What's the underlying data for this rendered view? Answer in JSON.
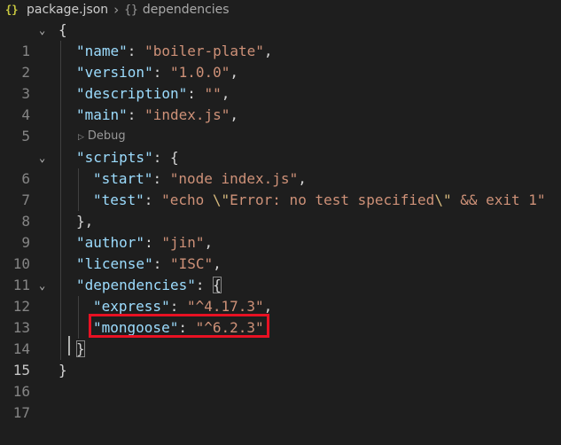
{
  "breadcrumb": {
    "file_icon": "{}",
    "file_name": "package.json",
    "separator": "›",
    "symbol_icon": "{}",
    "symbol_name": "dependencies"
  },
  "codelens": {
    "label": "Debug",
    "icon": "play-triangle-icon"
  },
  "lines": [
    {
      "num": "1",
      "fold": "⌄"
    },
    {
      "num": "2"
    },
    {
      "num": "3"
    },
    {
      "num": "4"
    },
    {
      "num": "5"
    },
    {
      "num": "6",
      "fold": "⌄"
    },
    {
      "num": "7"
    },
    {
      "num": "8"
    },
    {
      "num": "9"
    },
    {
      "num": "10"
    },
    {
      "num": "11"
    },
    {
      "num": "12",
      "fold": "⌄"
    },
    {
      "num": "13"
    },
    {
      "num": "14"
    },
    {
      "num": "15"
    },
    {
      "num": "16"
    },
    {
      "num": "17"
    }
  ],
  "code": {
    "l1": "{",
    "l2_key": "\"name\"",
    "l2_val": "\"boiler-plate\"",
    "l3_key": "\"version\"",
    "l3_val": "\"1.0.0\"",
    "l4_key": "\"description\"",
    "l4_val": "\"\"",
    "l5_key": "\"main\"",
    "l5_val": "\"index.js\"",
    "l6_key": "\"scripts\"",
    "l7_key": "\"start\"",
    "l7_val": "\"node index.js\"",
    "l8_key": "\"test\"",
    "l8_val_a": "\"echo ",
    "l8_esc1": "\\\"",
    "l8_val_b": "Error: no test specified",
    "l8_esc2": "\\\"",
    "l8_val_c": " && exit 1\"",
    "l9": "},",
    "l10_key": "\"author\"",
    "l10_val": "\"jin\"",
    "l11_key": "\"license\"",
    "l11_val": "\"ISC\"",
    "l12_key": "\"dependencies\"",
    "l13_key": "\"express\"",
    "l13_val": "\"^4.17.3\"",
    "l14_key": "\"mongoose\"",
    "l14_val": "\"^6.2.3\"",
    "l15": "}",
    "l16": "}"
  },
  "colors": {
    "background": "#1e1e1e",
    "key": "#9cdcfe",
    "string": "#ce9178",
    "escape": "#d7ba7d",
    "highlight_border": "#e81123"
  }
}
